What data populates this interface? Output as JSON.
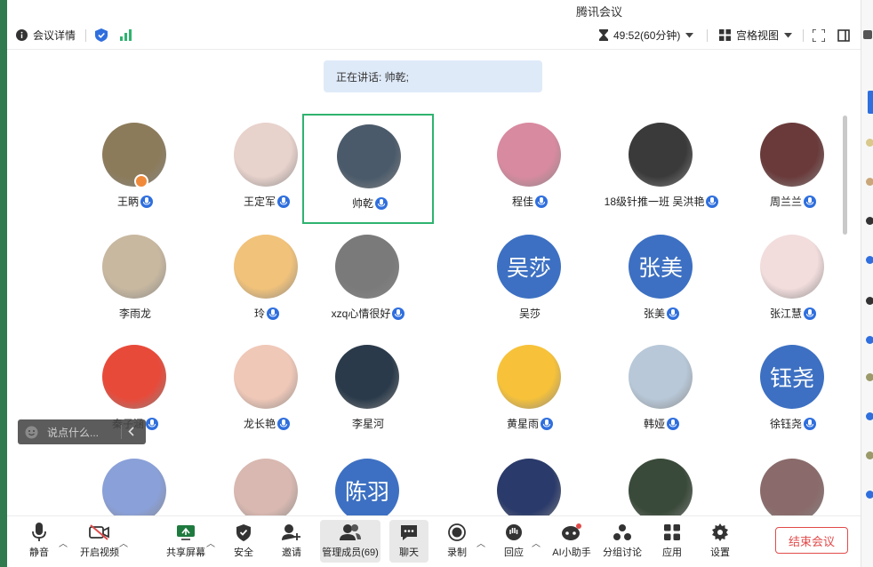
{
  "window": {
    "title": "腾讯会议"
  },
  "toolbar": {
    "meeting_details": "会议详情",
    "timer": "49:52(60分钟)",
    "view_mode": "宫格视图"
  },
  "speaking": {
    "text": "正在讲话: 帅乾;"
  },
  "participants": [
    {
      "name": "王眪",
      "mic": true
    },
    {
      "name": "王定军",
      "mic": true
    },
    {
      "name": "帅乾",
      "mic": true,
      "active": true
    },
    {
      "name": "程佳",
      "mic": true
    },
    {
      "name": "18级针推一班 吴洪艳",
      "mic": true
    },
    {
      "name": "周兰兰",
      "mic": true
    },
    {
      "name": "李雨龙",
      "mic": false
    },
    {
      "name": "玲",
      "mic": true
    },
    {
      "name": "xzq心情很好",
      "mic": true
    },
    {
      "name": "吴莎",
      "mic": false,
      "initials": "吴莎"
    },
    {
      "name": "张美",
      "mic": true,
      "initials": "张美"
    },
    {
      "name": "张江慧",
      "mic": true
    },
    {
      "name": "秦子涵",
      "mic": true
    },
    {
      "name": "龙长艳",
      "mic": true
    },
    {
      "name": "李星河",
      "mic": false
    },
    {
      "name": "黄星雨",
      "mic": true
    },
    {
      "name": "韩娅",
      "mic": true
    },
    {
      "name": "徐钰尧",
      "mic": true,
      "initials": "钰尧"
    },
    {
      "name": "",
      "mic": false
    },
    {
      "name": "",
      "mic": false
    },
    {
      "name": "",
      "mic": false,
      "initials": "陈羽"
    },
    {
      "name": "",
      "mic": false
    },
    {
      "name": "",
      "mic": false
    },
    {
      "name": "",
      "mic": false
    }
  ],
  "chat": {
    "placeholder": "说点什么..."
  },
  "bottom": {
    "mute": "静音",
    "video": "开启视频",
    "share": "共享屏幕",
    "security": "安全",
    "invite": "邀请",
    "members": "管理成员(69)",
    "chat": "聊天",
    "record": "录制",
    "react": "回应",
    "ai": "AI小助手",
    "breakout": "分组讨论",
    "apps": "应用",
    "settings": "设置",
    "end": "结束会议"
  },
  "colors": {
    "accent": "#3d70c2",
    "active_border": "#2fb36f",
    "end": "#e24a4a"
  }
}
